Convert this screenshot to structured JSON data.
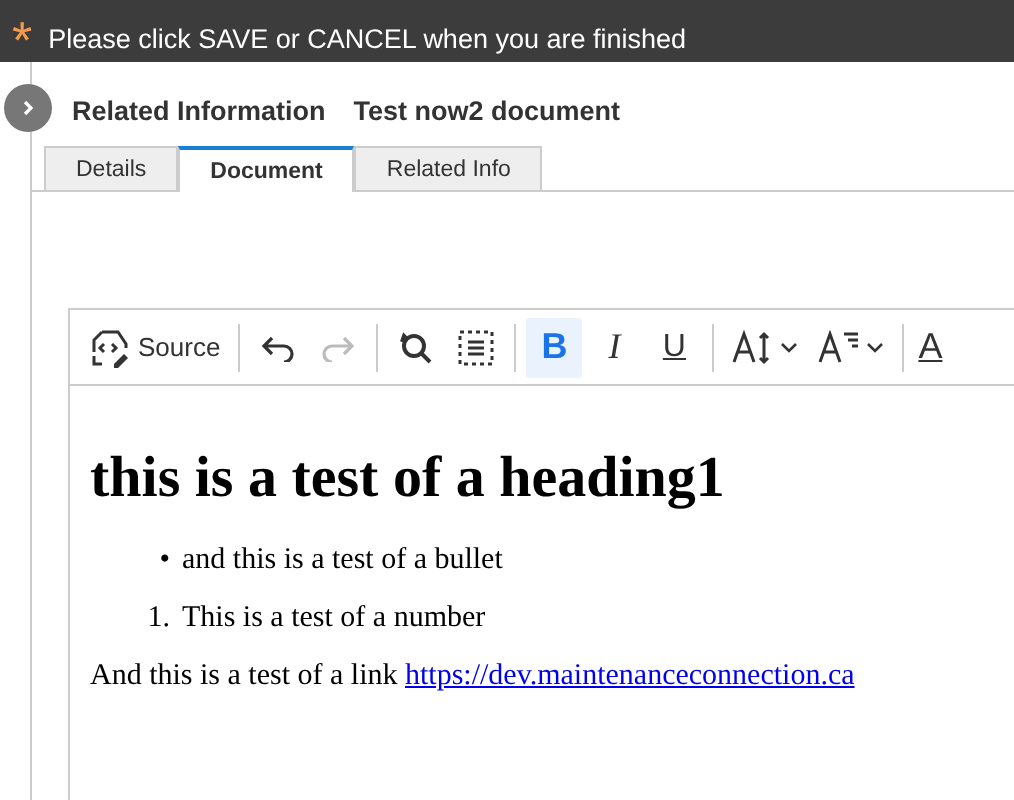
{
  "banner": {
    "mark": "*",
    "text": "Please click SAVE or CANCEL when you are finished"
  },
  "header": {
    "title": "Related Information",
    "subtitle": "Test now2 document"
  },
  "tabs": [
    {
      "label": "Details",
      "selected": false
    },
    {
      "label": "Document",
      "selected": true
    },
    {
      "label": "Related Info",
      "selected": false
    }
  ],
  "toolbar": {
    "groups": [
      [
        {
          "kind": "source",
          "label": "Source"
        }
      ],
      [
        {
          "kind": "undo",
          "disabled": false
        },
        {
          "kind": "redo",
          "disabled": true
        }
      ],
      [
        {
          "kind": "find",
          "disabled": false
        },
        {
          "kind": "select-all",
          "disabled": false
        }
      ],
      [
        {
          "kind": "bold",
          "label": "B",
          "on": true
        },
        {
          "kind": "italic",
          "label": "I",
          "on": false
        },
        {
          "kind": "underline",
          "label": "U",
          "on": false
        }
      ],
      [
        {
          "kind": "font-size"
        },
        {
          "kind": "font-format"
        }
      ],
      [
        {
          "kind": "font-color",
          "label": "A"
        }
      ]
    ]
  },
  "content": {
    "heading": "this is a test of a heading1",
    "bullets": [
      {
        "marker": "•",
        "text": "and this is a test of a bullet"
      }
    ],
    "numbered": [
      {
        "marker": "1.",
        "text": "This is a test of a number"
      }
    ],
    "paragraph": "And this is a test of a link",
    "link": "https://dev.maintenanceconnection.ca"
  }
}
